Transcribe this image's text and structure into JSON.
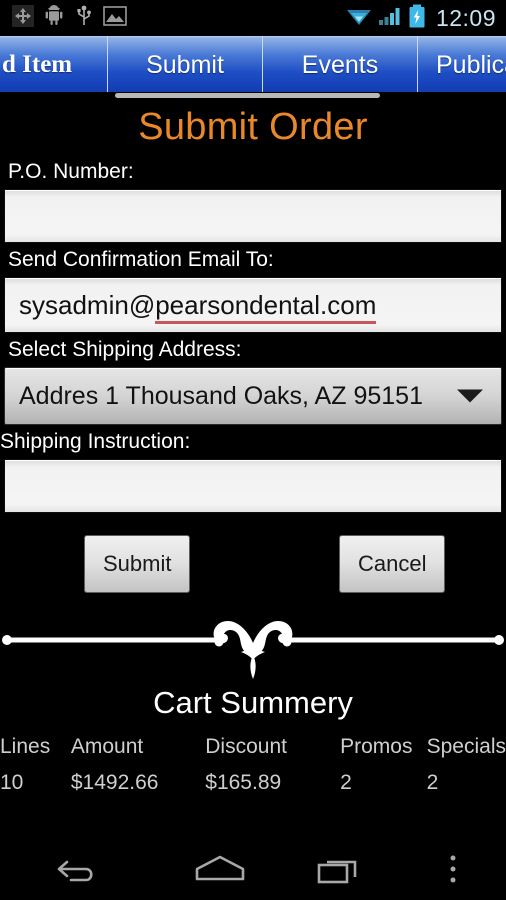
{
  "status_bar": {
    "icons": [
      "move-tool-icon",
      "android-robot-icon",
      "usb-icon",
      "picture-icon"
    ],
    "wifi_icon": "wifi-icon",
    "signal_icon": "cellular-signal-icon",
    "battery_icon": "battery-charging-icon",
    "time": "12:09"
  },
  "tabs": [
    {
      "label": "d Item"
    },
    {
      "label": "Submit"
    },
    {
      "label": "Events"
    },
    {
      "label": "Publica"
    }
  ],
  "page": {
    "title": "Submit Order",
    "title_color": "#e8882a"
  },
  "form": {
    "po_number": {
      "label": "P.O. Number:",
      "value": "",
      "placeholder": ""
    },
    "email": {
      "label": "Send Confirmation Email To:",
      "value_prefix": "sysadmin@",
      "value_misspelled": "pearsondental.com",
      "value": "sysadmin@pearsondental.com",
      "spellcheck_underline_color": "#c8575c"
    },
    "shipping_address": {
      "label": "Select Shipping Address:",
      "selected": "Addres 1  Thousand Oaks, AZ 95151",
      "caret_icon": "chevron-down-icon"
    },
    "shipping_instruction": {
      "label": "Shipping Instruction:",
      "value": "",
      "placeholder": ""
    },
    "submit_label": "Submit",
    "cancel_label": "Cancel"
  },
  "divider": {
    "icon": "ornamental-flourish-divider"
  },
  "summary": {
    "title": "Cart Summery",
    "headers": [
      "Lines",
      "Amount",
      "Discount",
      "Promos",
      "Specials"
    ],
    "values": [
      "10",
      "$1492.66",
      "$165.89",
      "2",
      "2"
    ]
  },
  "nav_bar": {
    "back": "back-icon",
    "home": "home-icon",
    "recent": "recent-apps-icon",
    "menu": "overflow-menu-icon"
  }
}
